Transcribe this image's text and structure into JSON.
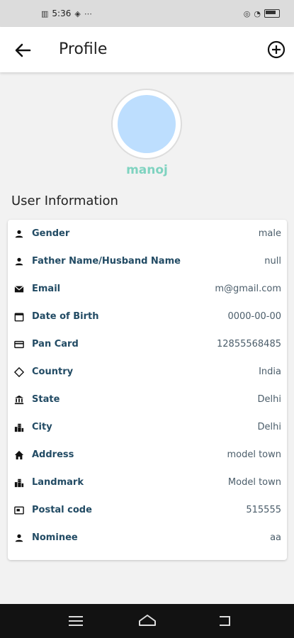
{
  "status_bar": {
    "time": "5:36",
    "indicators": "⋯"
  },
  "appbar": {
    "title": "Profile"
  },
  "profile": {
    "name": "manoj"
  },
  "section": {
    "title": "User Information"
  },
  "fields": [
    {
      "label": "Gender",
      "value": "male",
      "icon": "person-icon"
    },
    {
      "label": "Father Name/Husband Name",
      "value": "null",
      "icon": "person-icon"
    },
    {
      "label": "Email",
      "value": "m@gmail.com",
      "icon": "email-icon"
    },
    {
      "label": "Date of Birth",
      "value": "0000-00-00",
      "icon": "calendar-icon"
    },
    {
      "label": "Pan Card",
      "value": "12855568485",
      "icon": "card-icon"
    },
    {
      "label": "Country",
      "value": "India",
      "icon": "diamond-icon"
    },
    {
      "label": "State",
      "value": "Delhi",
      "icon": "bank-icon"
    },
    {
      "label": "City",
      "value": "Delhi",
      "icon": "city-icon"
    },
    {
      "label": "Address",
      "value": "model town",
      "icon": "home-icon"
    },
    {
      "label": "Landmark",
      "value": "Model town",
      "icon": "city-icon"
    },
    {
      "label": "Postal code",
      "value": "515555",
      "icon": "postal-icon"
    },
    {
      "label": "Nominee",
      "value": "aa",
      "icon": "person-icon"
    }
  ],
  "colors": {
    "accent": "#7fd3c0",
    "label": "#224b64",
    "avatar": "#bddefe"
  }
}
